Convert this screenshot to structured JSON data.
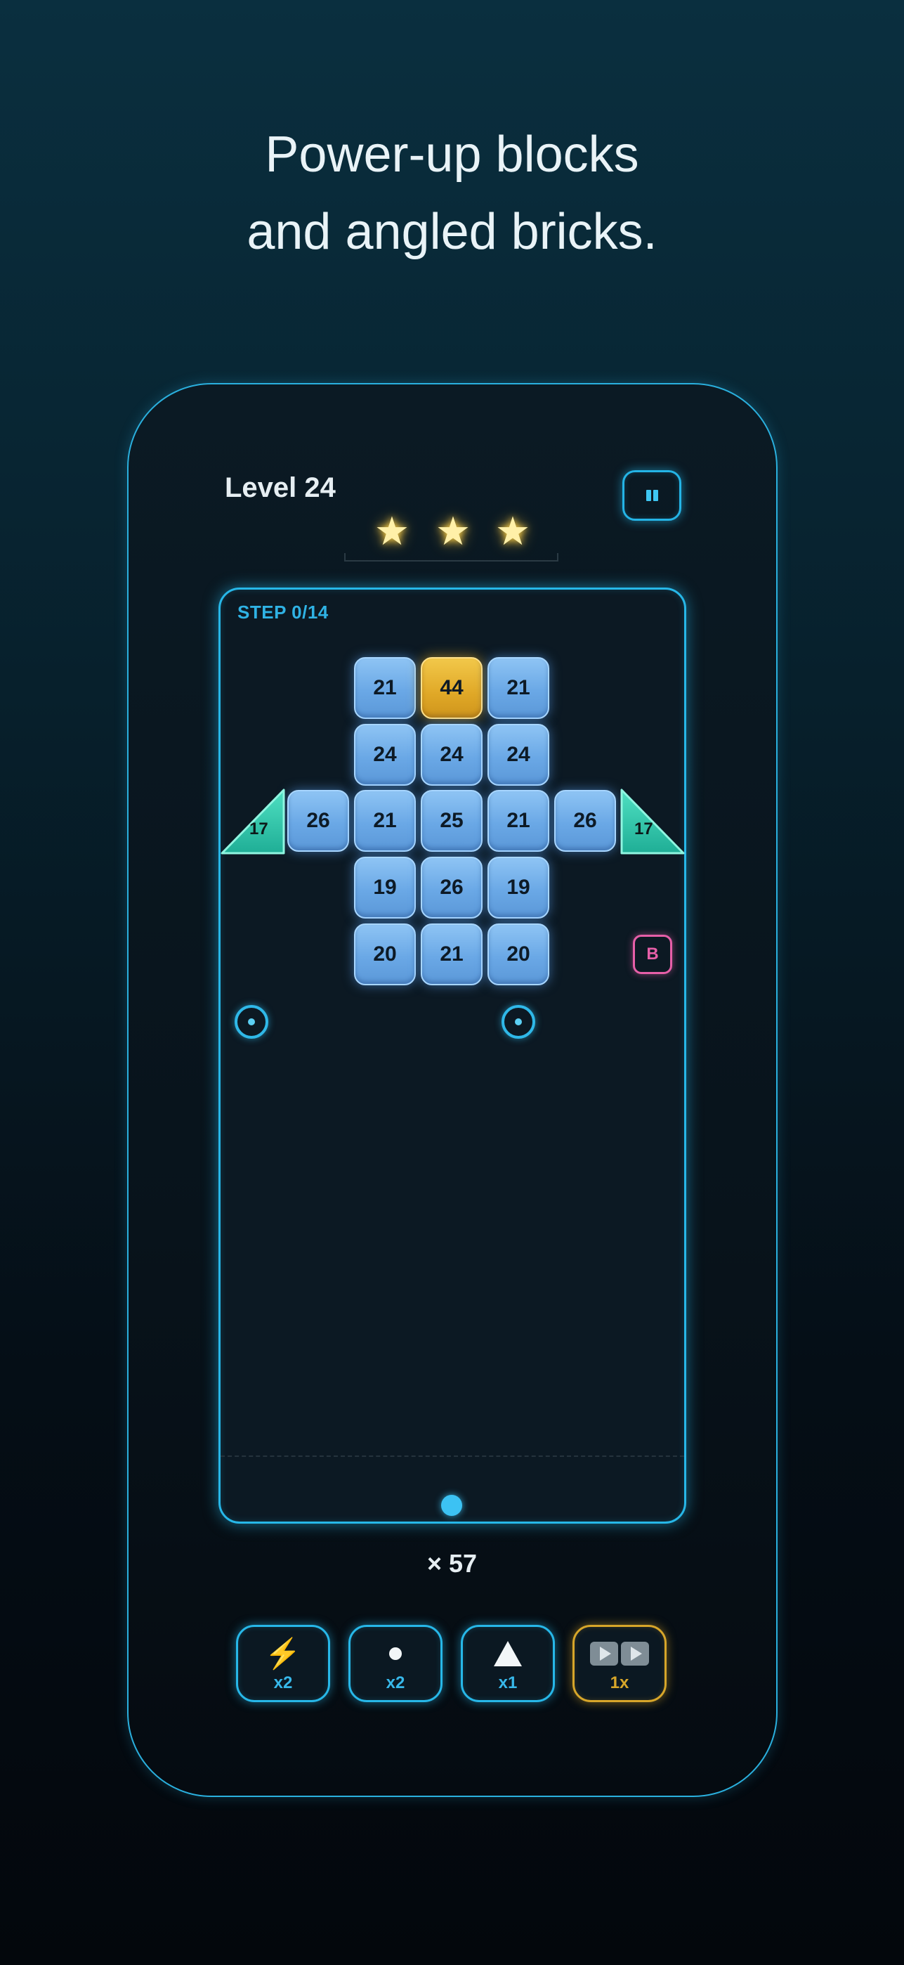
{
  "headline": {
    "line1": "Power-up blocks",
    "line2": "and angled bricks."
  },
  "game": {
    "level_title": "Level 24",
    "stars_earned": 3,
    "stars_total": 3,
    "pause_icon": "pause-icon",
    "step_label": "STEP 0/14",
    "ball_count": "× 57",
    "bonus_block": "B",
    "accent_color": "#27b7e8",
    "gold_color": "#e0a827"
  },
  "bricks": {
    "r1c1": "21",
    "r1c2": "44",
    "r1c3": "21",
    "r2c1": "24",
    "r2c2": "24",
    "r2c3": "24",
    "r3_left": "26",
    "r3c1": "21",
    "r3c2": "25",
    "r3c3": "21",
    "r3_right": "26",
    "r4c1": "19",
    "r4c2": "26",
    "r4c3": "19",
    "r5c1": "20",
    "r5c2": "21",
    "r5c3": "20",
    "tri_left": "17",
    "tri_right": "17"
  },
  "powerups": [
    {
      "icon": "lightning-icon",
      "count": "x2"
    },
    {
      "icon": "ball-icon",
      "count": "x2"
    },
    {
      "icon": "triangle-icon",
      "count": "x1"
    },
    {
      "icon": "fast-forward-icon",
      "count": "1x"
    }
  ]
}
